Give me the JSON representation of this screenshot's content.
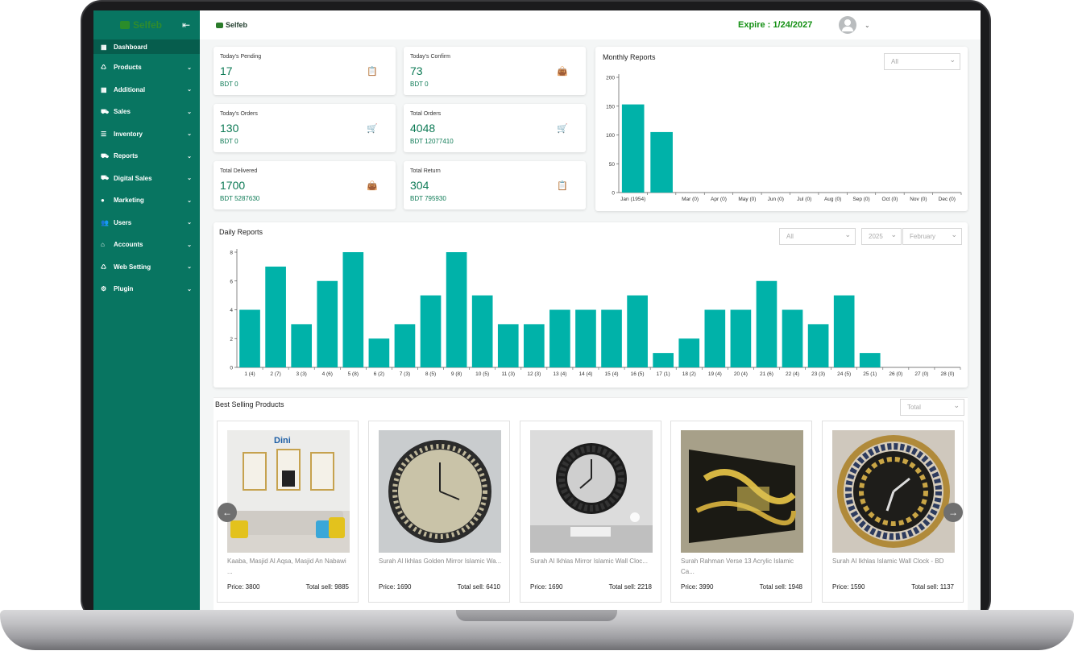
{
  "app": {
    "brand": "Selfeb",
    "expire_text": "Expire : 1/24/2027"
  },
  "sidebar": {
    "items": [
      {
        "label": "Dashboard",
        "icon": "dashboard-icon"
      },
      {
        "label": "Products",
        "icon": "basket-icon"
      },
      {
        "label": "Additional",
        "icon": "grid-icon"
      },
      {
        "label": "Sales",
        "icon": "cart-icon"
      },
      {
        "label": "Inventory",
        "icon": "list-icon"
      },
      {
        "label": "Reports",
        "icon": "cart-icon"
      },
      {
        "label": "Digital Sales",
        "icon": "cart-icon"
      },
      {
        "label": "Marketing",
        "icon": "megaphone-icon"
      },
      {
        "label": "Users",
        "icon": "users-icon"
      },
      {
        "label": "Accounts",
        "icon": "bank-icon"
      },
      {
        "label": "Web Setting",
        "icon": "basket-icon"
      },
      {
        "label": "Plugin",
        "icon": "plug-icon"
      }
    ]
  },
  "stats": [
    {
      "label": "Today's Pending",
      "value": "17",
      "sub": "BDT 0",
      "icon": "clipboard-clock-icon"
    },
    {
      "label": "Today's Confirm",
      "value": "73",
      "sub": "BDT 0",
      "icon": "shopping-bag-icon"
    },
    {
      "label": "Today's Orders",
      "value": "130",
      "sub": "BDT 0",
      "icon": "cart-plus-icon"
    },
    {
      "label": "Total Orders",
      "value": "4048",
      "sub": "BDT 12077410",
      "icon": "cart-plus-icon"
    },
    {
      "label": "Total Delivered",
      "value": "1700",
      "sub": "BDT 5287630",
      "icon": "shopping-bag-icon"
    },
    {
      "label": "Total Return",
      "value": "304",
      "sub": "BDT 795930",
      "icon": "clipboard-clock-icon"
    }
  ],
  "monthly": {
    "title": "Monthly Reports",
    "filter": "All"
  },
  "daily": {
    "title": "Daily Reports",
    "filter": "All",
    "year": "2025",
    "month": "February"
  },
  "best": {
    "title": "Best Selling Products",
    "filter": "Total"
  },
  "products": [
    {
      "name": "Kaaba, Masjid Al Aqsa, Masjid An Nabawi ...",
      "price": "Price: 3800",
      "sold": "Total sell: 9885"
    },
    {
      "name": "Surah Al Ikhlas Golden Mirror Islamic Wa...",
      "price": "Price: 1690",
      "sold": "Total sell: 6410"
    },
    {
      "name": "Surah Al Ikhlas Mirror Islamic Wall Cloc...",
      "price": "Price: 1690",
      "sold": "Total sell: 2218"
    },
    {
      "name": "Surah Rahman Verse 13 Acrylic Islamic Ca...",
      "price": "Price: 3990",
      "sold": "Total sell: 1948"
    },
    {
      "name": "Surah Al Ikhlas Islamic Wall Clock - BD",
      "price": "Price: 1590",
      "sold": "Total sell: 1137"
    }
  ],
  "colors": {
    "sidebar": "#087561",
    "bar": "#00b2a9",
    "accent_text": "#0d7a55",
    "expire": "#149014"
  },
  "chart_data": [
    {
      "type": "bar",
      "title": "Monthly Reports",
      "categories": [
        "Jan (1954)",
        "",
        "Mar (0)",
        "Apr (0)",
        "May (0)",
        "Jun (0)",
        "Jul (0)",
        "Aug (0)",
        "Sep (0)",
        "Oct (0)",
        "Nov (0)",
        "Dec (0)"
      ],
      "values": [
        153,
        105,
        0,
        0,
        0,
        0,
        0,
        0,
        0,
        0,
        0,
        0
      ],
      "ylim": [
        0,
        200
      ],
      "yticks": [
        0,
        50,
        100,
        150,
        200
      ],
      "grid": false
    },
    {
      "type": "bar",
      "title": "Daily Reports",
      "categories": [
        "1 (4)",
        "2 (7)",
        "3 (3)",
        "4 (6)",
        "5 (8)",
        "6 (2)",
        "7 (3)",
        "8 (5)",
        "9 (8)",
        "10 (5)",
        "11 (3)",
        "12 (3)",
        "13 (4)",
        "14 (4)",
        "15 (4)",
        "16 (5)",
        "17 (1)",
        "18 (2)",
        "19 (4)",
        "20 (4)",
        "21 (6)",
        "22 (4)",
        "23 (3)",
        "24 (5)",
        "25 (1)",
        "26 (0)",
        "27 (0)",
        "28 (0)"
      ],
      "values": [
        4,
        7,
        3,
        6,
        8,
        2,
        3,
        5,
        8,
        5,
        3,
        3,
        4,
        4,
        4,
        5,
        1,
        2,
        4,
        4,
        6,
        4,
        3,
        5,
        1,
        0,
        0,
        0
      ],
      "ylim": [
        0,
        8
      ],
      "yticks": [
        0,
        2,
        4,
        6,
        8
      ],
      "grid": false
    }
  ]
}
